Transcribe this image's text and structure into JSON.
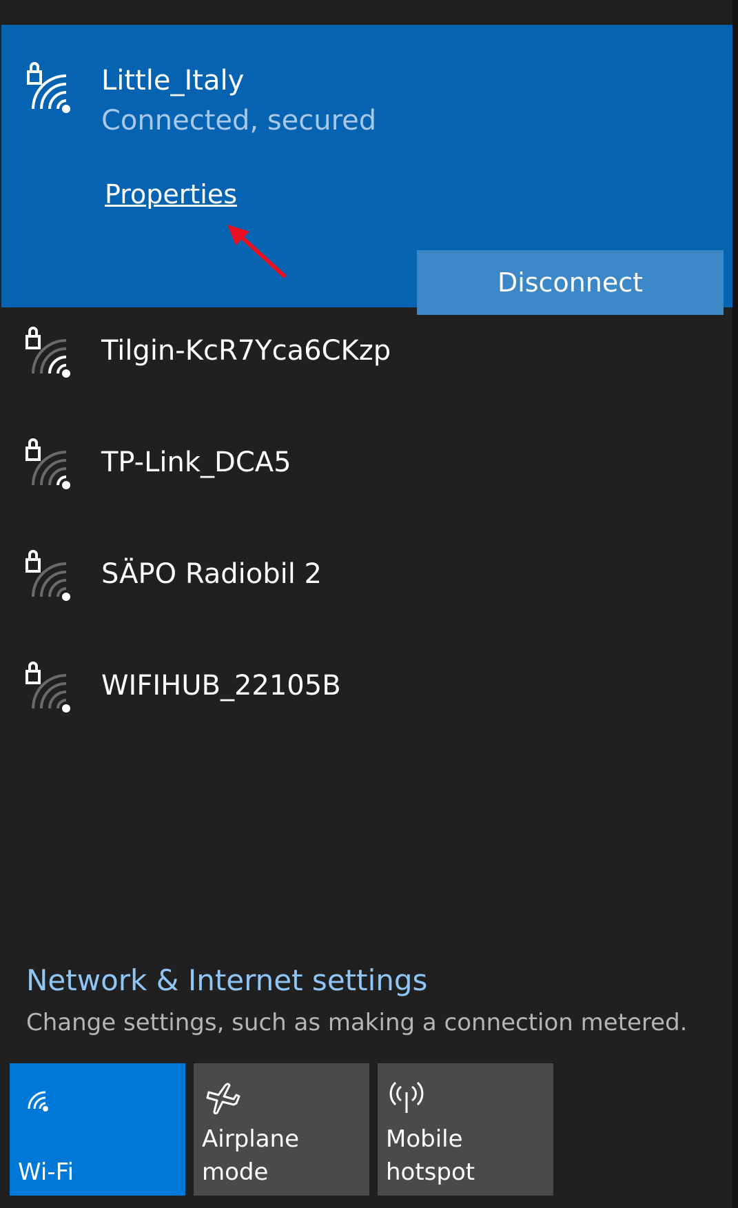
{
  "connected_network": {
    "ssid": "Little_Italy",
    "status": "Connected, secured",
    "properties_label": "Properties",
    "disconnect_label": "Disconnect"
  },
  "networks": [
    {
      "ssid": "Tilgin-KcR7Yca6CKzp",
      "secured": true,
      "signal_icon": "wifi-2-bars-icon"
    },
    {
      "ssid": "TP-Link_DCA5",
      "secured": true,
      "signal_icon": "wifi-2-bars-icon"
    },
    {
      "ssid": "SÄPO Radiobil 2",
      "secured": true,
      "signal_icon": "wifi-1-bar-icon"
    },
    {
      "ssid": "WIFIHUB_22105B",
      "secured": true,
      "signal_icon": "wifi-1-bar-icon"
    }
  ],
  "settings": {
    "link": "Network & Internet settings",
    "description": "Change settings, such as making a connection metered."
  },
  "quick_actions": [
    {
      "label": "Wi-Fi",
      "icon": "wifi-icon",
      "active": true
    },
    {
      "label": "Airplane mode",
      "icon": "airplane-icon",
      "active": false
    },
    {
      "label": "Mobile\nhotspot",
      "icon": "hotspot-icon",
      "active": false
    }
  ],
  "colors": {
    "accent": "#0078d7",
    "connected_bg": "#0563b1",
    "link": "#8fc6f5",
    "annotation_arrow": "#e81123"
  }
}
